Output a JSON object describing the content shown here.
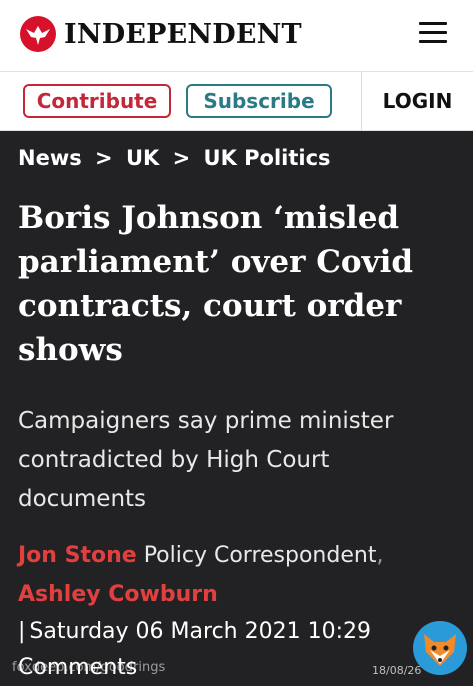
{
  "header": {
    "brand": "INDEPENDENT",
    "logo_icon": "eagle-icon",
    "menu_icon": "hamburger-menu-icon"
  },
  "actions": {
    "contribute_label": "Contribute",
    "subscribe_label": "Subscribe",
    "login_label": "LOGIN"
  },
  "colors": {
    "brand_red": "#d6122b",
    "contribute": "#c42738",
    "subscribe": "#2b7b86",
    "author_red": "#e2403f",
    "article_bg": "#222224"
  },
  "breadcrumb": {
    "items": [
      "News",
      "UK",
      "UK Politics"
    ],
    "separator": ">"
  },
  "article": {
    "headline": "Boris Johnson ‘misled parliament’ over Covid contracts, court order shows",
    "standfirst": "Campaigners say prime minister contradicted by High Court documents",
    "authors": [
      {
        "name": "Jon Stone",
        "role": "Policy Correspondent"
      },
      {
        "name": "Ashley Cowburn"
      }
    ],
    "byline_comma": ",",
    "date_bar": "|",
    "date": "Saturday 06 March 2021 10:29",
    "comments_label": "Comments"
  },
  "overlay": {
    "watermark_left": "foxdeep.com/goodrings",
    "watermark_right": "18/08/26",
    "badge_icon": "fox-icon"
  }
}
